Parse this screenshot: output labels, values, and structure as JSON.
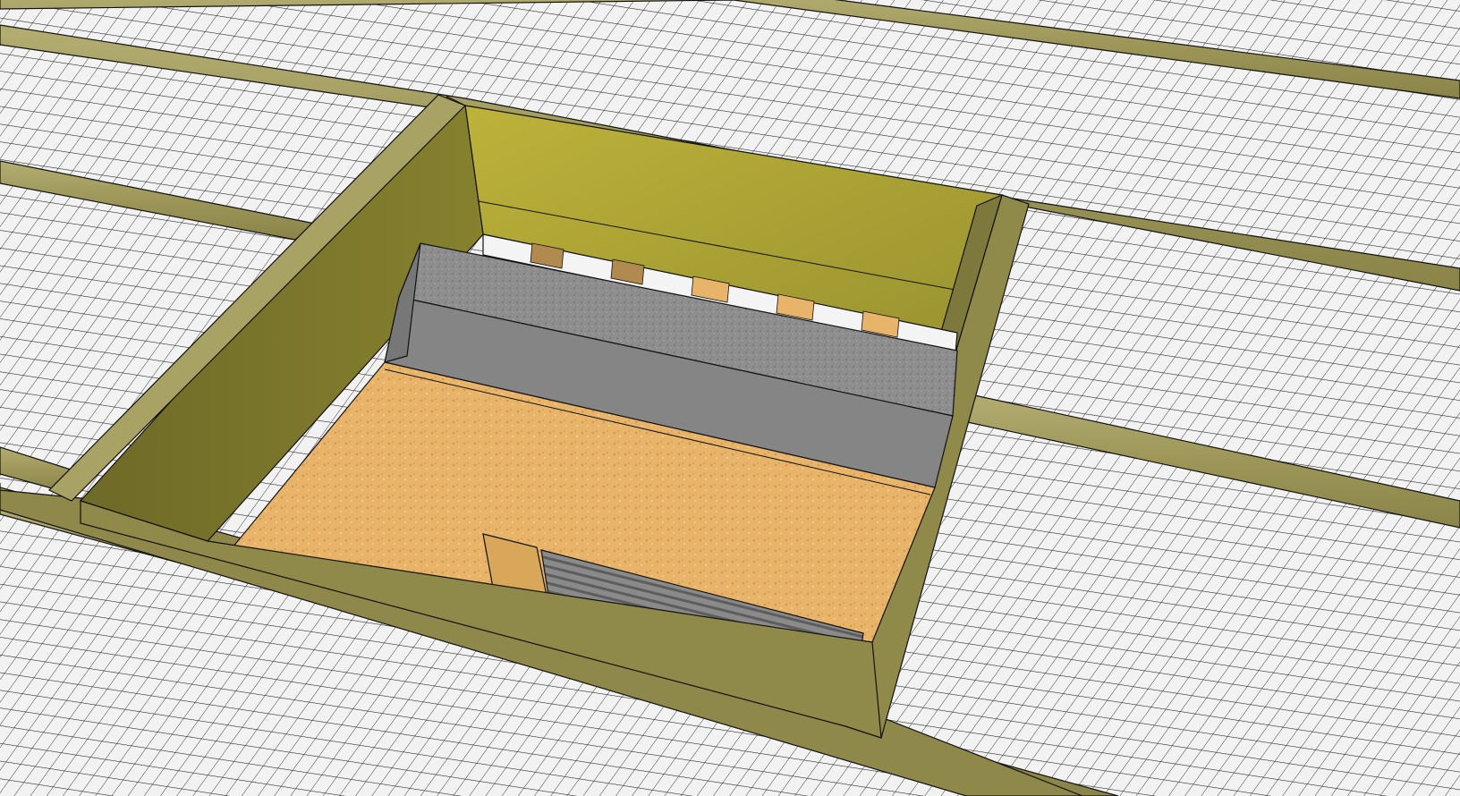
{
  "scene": {
    "view": "3d-perspective",
    "subject": "floor-joist-framing-with-stair-opening",
    "colors": {
      "grid_background": "#f2f2f2",
      "grid_line": "#1a1a1a",
      "joist_wood": "#a09a5c",
      "joist_wood_dark": "#7f7a42",
      "header_wood": "#b3a83b",
      "header_wood_dark": "#8f8a2c",
      "osb_panel": "#e6b36c",
      "concrete_block": "#8d8d8d",
      "concrete_block_dark": "#7a7a7a",
      "insulation_strip": "#ffffff",
      "outline": "#111111"
    }
  }
}
